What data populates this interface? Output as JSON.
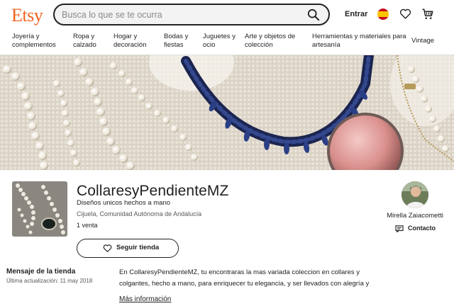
{
  "header": {
    "logo": "Etsy",
    "search_placeholder": "Busca lo que se te ocurra",
    "signin_label": "Entrar"
  },
  "nav": {
    "items": [
      {
        "line1": "Joyería y",
        "line2": "complementos"
      },
      {
        "line1": "Ropa y",
        "line2": "calzado"
      },
      {
        "line1": "Hogar y",
        "line2": "decoración"
      },
      {
        "line1": "Bodas y",
        "line2": "fiestas"
      },
      {
        "line1": "Juguetes y",
        "line2": "ocio"
      },
      {
        "line1": "Arte y objetos de",
        "line2": "colección"
      },
      {
        "line1": "Herramientas y materiales para",
        "line2": "artesanía"
      },
      {
        "line1": "Vintage",
        "line2": ""
      }
    ]
  },
  "shop": {
    "name": "CollaresyPendienteMZ",
    "tagline": "Diseños unicos hechos a mano",
    "location": "Cijuela, Comunidad Autónoma de Andalucía",
    "sales": "1 venta",
    "follow_label": "Seguir tienda"
  },
  "owner": {
    "name": "Mirella Zaiacometti",
    "contact_label": "Contacto"
  },
  "announcement": {
    "title": "Mensaje de la tienda",
    "updated": "Última actualización: 11 may 2018",
    "text": "En CollaresyPendienteMZ, tu encontraras la mas variada coleccion en collares y colgantes, hecho a mano, para enriquecer tu elegancia, y ser llevados con alegría y",
    "more_label": "Más información"
  },
  "colors": {
    "brand": "#f1641e",
    "text": "#222222",
    "muted": "#595959"
  }
}
